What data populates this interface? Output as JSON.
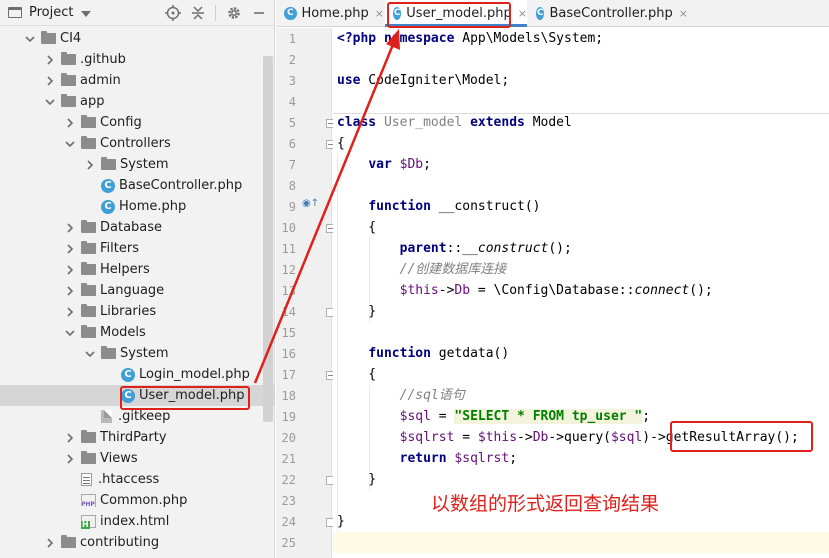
{
  "project_panel": {
    "title": "Project",
    "tree": [
      {
        "label": "CI4",
        "type": "folder",
        "depth": 0,
        "expanded": true
      },
      {
        "label": ".github",
        "type": "folder",
        "depth": 1,
        "expanded": false
      },
      {
        "label": "admin",
        "type": "folder",
        "depth": 1,
        "expanded": false
      },
      {
        "label": "app",
        "type": "folder",
        "depth": 1,
        "expanded": true
      },
      {
        "label": "Config",
        "type": "folder",
        "depth": 2,
        "expanded": false
      },
      {
        "label": "Controllers",
        "type": "folder",
        "depth": 2,
        "expanded": true
      },
      {
        "label": "System",
        "type": "folder",
        "depth": 3,
        "expanded": false
      },
      {
        "label": "BaseController.php",
        "type": "class",
        "depth": 3
      },
      {
        "label": "Home.php",
        "type": "class",
        "depth": 3
      },
      {
        "label": "Database",
        "type": "folder",
        "depth": 2,
        "expanded": false
      },
      {
        "label": "Filters",
        "type": "folder",
        "depth": 2,
        "expanded": false
      },
      {
        "label": "Helpers",
        "type": "folder",
        "depth": 2,
        "expanded": false
      },
      {
        "label": "Language",
        "type": "folder",
        "depth": 2,
        "expanded": false
      },
      {
        "label": "Libraries",
        "type": "folder",
        "depth": 2,
        "expanded": false
      },
      {
        "label": "Models",
        "type": "folder",
        "depth": 2,
        "expanded": true
      },
      {
        "label": "System",
        "type": "folder",
        "depth": 3,
        "expanded": true
      },
      {
        "label": "Login_model.php",
        "type": "class",
        "depth": 4
      },
      {
        "label": "User_model.php",
        "type": "class",
        "depth": 4,
        "selected": true
      },
      {
        "label": ".gitkeep",
        "type": "git",
        "depth": 3
      },
      {
        "label": "ThirdParty",
        "type": "folder",
        "depth": 2,
        "expanded": false
      },
      {
        "label": "Views",
        "type": "folder",
        "depth": 2,
        "expanded": false
      },
      {
        "label": ".htaccess",
        "type": "htaccess",
        "depth": 2
      },
      {
        "label": "Common.php",
        "type": "php",
        "depth": 2
      },
      {
        "label": "index.html",
        "type": "html",
        "depth": 2
      },
      {
        "label": "contributing",
        "type": "folder",
        "depth": 1,
        "expanded": false
      }
    ]
  },
  "tabs": [
    {
      "label": "Home.php",
      "close": "×",
      "active": false
    },
    {
      "label": "User_model.php",
      "close": "×",
      "active": true
    },
    {
      "label": "BaseController.php",
      "close": "×",
      "active": false
    }
  ],
  "editor": {
    "line_numbers": [
      "1",
      "2",
      "3",
      "4",
      "5",
      "6",
      "7",
      "8",
      "9",
      "10",
      "11",
      "12",
      "13",
      "14",
      "15",
      "16",
      "17",
      "18",
      "19",
      "20",
      "21",
      "22",
      "23",
      "24",
      "25"
    ]
  },
  "annotation": "以数组的形式返回查询结果",
  "colors": {
    "highlight_red": "#e0201a",
    "active_tab_underline": "#4083c9",
    "keyword": "#000080",
    "variable": "#660e7a",
    "string": "#008000",
    "comment": "#808080"
  }
}
